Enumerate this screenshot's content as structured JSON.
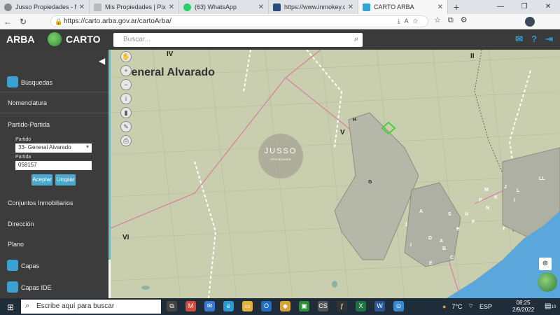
{
  "tabs": [
    {
      "title": "Jusso Propiedades - Mar del"
    },
    {
      "title": "Mis Propiedades | Pixel Inmo"
    },
    {
      "title": "(63) WhatsApp"
    },
    {
      "title": "https://www.inmokey.com/in"
    },
    {
      "title": "CARTO ARBA"
    }
  ],
  "browser": {
    "url": "https://carto.arba.gov.ar/cartoArba/"
  },
  "app": {
    "brand": "ARBA",
    "product": "CARTO",
    "search_placeholder": "Buscar..."
  },
  "sidebar": {
    "busquedas": "Búsquedas",
    "nomenclatura": "Nomenclatura",
    "partido_partida": "Partido-Partida",
    "partido_label": "Partido",
    "partido_value": "33- General Alvarado",
    "partida_label": "Partida",
    "partida_value": "058157",
    "aceptar": "Aceptar",
    "limpiar": "Limpiar",
    "conjuntos": "Conjuntos Inmobiliarios",
    "direccion": "Dirección",
    "plano": "Plano",
    "capas": "Capas",
    "capas_ide": "Capas IDE"
  },
  "map": {
    "title": "General Alvarado",
    "labels": [
      "IV",
      "II",
      "V",
      "VI",
      "H",
      "G",
      "A",
      "S",
      "H",
      "F",
      "E",
      "N",
      "P",
      "K",
      "J",
      "L",
      "M",
      "I",
      "LL",
      "C",
      "B",
      "D",
      "A",
      "E",
      "I",
      "J"
    ],
    "watermark": "JUSSO",
    "watermark_sub": "PROPIEDADES"
  },
  "taskbar": {
    "search_placeholder": "Escribe aquí para buscar",
    "temperature": "7°C",
    "language": "ESP",
    "time": "08:25",
    "date": "2/9/2022",
    "notif_count": "10"
  }
}
